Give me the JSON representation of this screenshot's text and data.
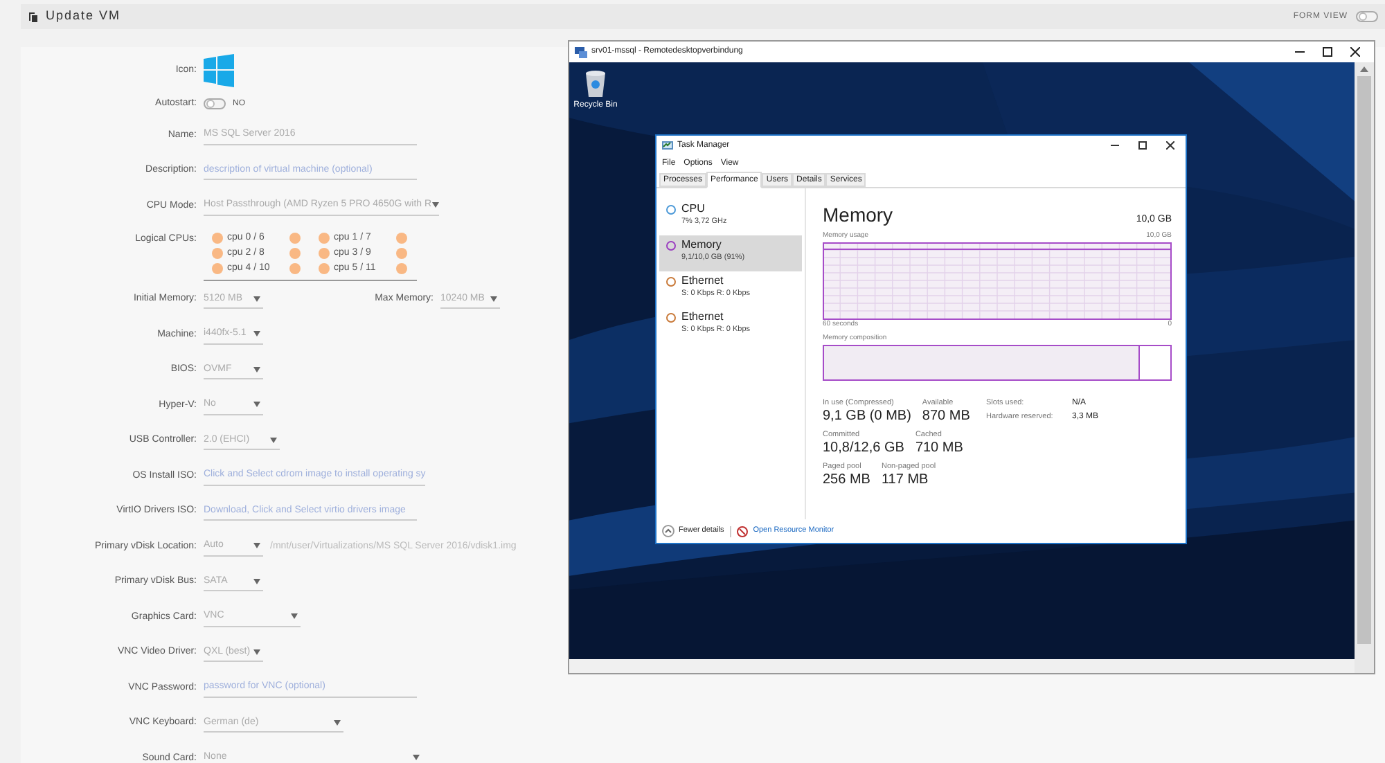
{
  "header": {
    "title": "Update VM",
    "form_view": {
      "label": "FORM VIEW",
      "on": false
    }
  },
  "form": {
    "fields": [
      {
        "kind": "icon",
        "label": "Icon:"
      },
      {
        "kind": "toggle",
        "label": "Autostart:",
        "on": false,
        "value": "NO"
      },
      {
        "kind": "input",
        "label": "Name:",
        "value": "MS SQL Server 2016"
      },
      {
        "kind": "input",
        "label": "Description:",
        "placeholder": "description of virtual machine (optional)"
      },
      {
        "kind": "select",
        "label": "CPU Mode:",
        "value": "Host Passthrough (AMD Ryzen 5 PRO 4650G with R"
      },
      {
        "kind": "cpus",
        "label": "Logical CPUs:",
        "cpus": [
          {
            "label": "cpu 0 / 6",
            "checked": false,
            "pair_checked": false
          },
          {
            "label": "cpu 1 / 7",
            "checked": false,
            "pair_checked": false
          },
          {
            "label": "cpu 2 / 8",
            "checked": false,
            "pair_checked": false
          },
          {
            "label": "cpu 3 / 9",
            "checked": false,
            "pair_checked": false
          },
          {
            "label": "cpu 4 / 10",
            "checked": false,
            "pair_checked": false
          },
          {
            "label": "cpu 5 / 11",
            "checked": false,
            "pair_checked": false
          }
        ]
      },
      {
        "kind": "memory",
        "label": "Initial Memory:",
        "value": "5120 MB",
        "max_label": "Max Memory:",
        "max_value": "10240 MB"
      },
      {
        "kind": "select",
        "label": "Machine:",
        "value": "i440fx-5.1"
      },
      {
        "kind": "select",
        "label": "BIOS:",
        "value": "OVMF"
      },
      {
        "kind": "select",
        "label": "Hyper-V:",
        "value": "No"
      },
      {
        "kind": "select",
        "label": "USB Controller:",
        "value": "2.0 (EHCI)"
      },
      {
        "kind": "input",
        "label": "OS Install ISO:",
        "placeholder": "Click and Select cdrom image to install operating sy"
      },
      {
        "kind": "input",
        "label": "VirtIO Drivers ISO:",
        "placeholder": "Download, Click and Select virtio drivers image"
      },
      {
        "kind": "disk",
        "label": "Primary vDisk Location:",
        "value": "Auto",
        "path": "/mnt/user/Virtualizations/MS SQL Server 2016/vdisk1.img"
      },
      {
        "kind": "select",
        "label": "Primary vDisk Bus:",
        "value": "SATA"
      },
      {
        "kind": "select",
        "label": "Graphics Card:",
        "value": "VNC"
      },
      {
        "kind": "select",
        "label": "VNC Video Driver:",
        "value": "QXL (best)"
      },
      {
        "kind": "input",
        "label": "VNC Password:",
        "placeholder": "password for VNC (optional)"
      },
      {
        "kind": "select",
        "label": "VNC Keyboard:",
        "value": "German (de)"
      },
      {
        "kind": "select",
        "label": "Sound Card:",
        "value": "None"
      }
    ]
  },
  "remote_window": {
    "title": "srv01-mssql - Remotedesktopverbindung",
    "desktop_icons": [
      {
        "label": "Recycle Bin"
      }
    ],
    "task_manager": {
      "title": "Task Manager",
      "menu": [
        "File",
        "Options",
        "View"
      ],
      "tabs": [
        {
          "label": "Processes",
          "selected": false
        },
        {
          "label": "Performance",
          "selected": true
        },
        {
          "label": "Users",
          "selected": false
        },
        {
          "label": "Details",
          "selected": false
        },
        {
          "label": "Services",
          "selected": false
        }
      ],
      "resources": [
        {
          "name": "CPU",
          "detail": "7% 3,72 GHz",
          "color": "#4d9ad8",
          "selected": false
        },
        {
          "name": "Memory",
          "detail": "9,1/10,0 GB (91%)",
          "color": "#9b3fc0",
          "selected": true
        },
        {
          "name": "Ethernet",
          "detail": "S: 0 Kbps R: 0 Kbps",
          "color": "#c97a3a",
          "selected": false
        },
        {
          "name": "Ethernet",
          "detail": "S: 0 Kbps R: 0 Kbps",
          "color": "#c97a3a",
          "selected": false
        }
      ],
      "detail": {
        "title": "Memory",
        "total": "10,0 GB",
        "usage_label": "Memory usage",
        "usage_max": "10,0 GB",
        "time_start": "60 seconds",
        "time_end": "0",
        "composition": {
          "label": "Memory composition",
          "level": 0.91
        },
        "stats": [
          [
            {
              "label": "In use (Compressed)",
              "value": "9,1 GB (0 MB)"
            },
            {
              "label": "Available",
              "value": "870 MB"
            }
          ],
          [
            {
              "label": "Committed",
              "value": "10,8/12,6 GB"
            },
            {
              "label": "Cached",
              "value": "710 MB"
            }
          ],
          [
            {
              "label": "Paged pool",
              "value": "256 MB"
            },
            {
              "label": "Non-paged pool",
              "value": "117 MB"
            }
          ]
        ],
        "hardware": [
          {
            "label": "Slots used:",
            "value": "N/A"
          },
          {
            "label": "Hardware reserved:",
            "value": "3,3 MB"
          }
        ]
      },
      "footer": {
        "fewer": "Fewer details",
        "monitor": "Open Resource Monitor"
      }
    }
  }
}
